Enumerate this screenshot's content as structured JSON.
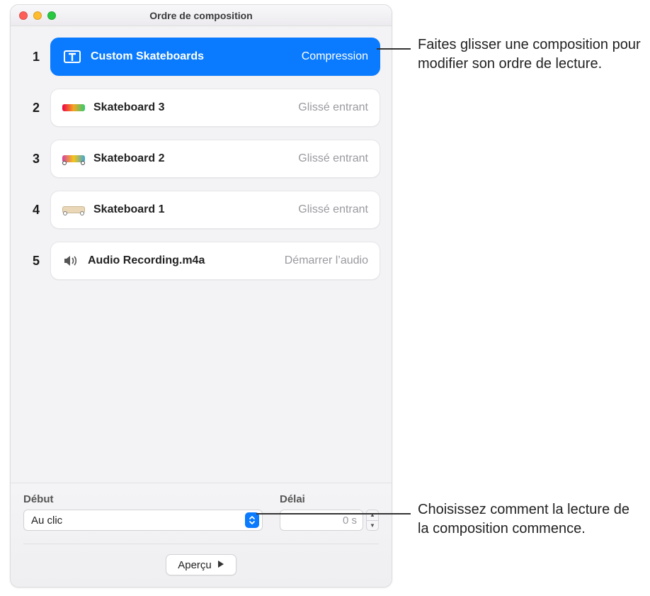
{
  "window": {
    "title": "Ordre de composition"
  },
  "rows": [
    {
      "num": "1",
      "label": "Custom Skateboards",
      "effect": "Compression",
      "icon": "text",
      "selected": true
    },
    {
      "num": "2",
      "label": "Skateboard 3",
      "effect": "Glissé entrant",
      "icon": "skate3",
      "selected": false
    },
    {
      "num": "3",
      "label": "Skateboard 2",
      "effect": "Glissé entrant",
      "icon": "skate2",
      "selected": false
    },
    {
      "num": "4",
      "label": "Skateboard 1",
      "effect": "Glissé entrant",
      "icon": "skate1",
      "selected": false
    },
    {
      "num": "5",
      "label": "Audio Recording.m4a",
      "effect": "Démarrer l’audio",
      "icon": "audio",
      "selected": false
    }
  ],
  "footer": {
    "start_label": "Début",
    "start_value": "Au clic",
    "delay_label": "Délai",
    "delay_value": "0 s",
    "preview_label": "Aperçu"
  },
  "callouts": {
    "top": "Faites glisser une composition pour modifier son ordre de lecture.",
    "bottom": "Choisissez comment la lecture de la composition commence."
  }
}
